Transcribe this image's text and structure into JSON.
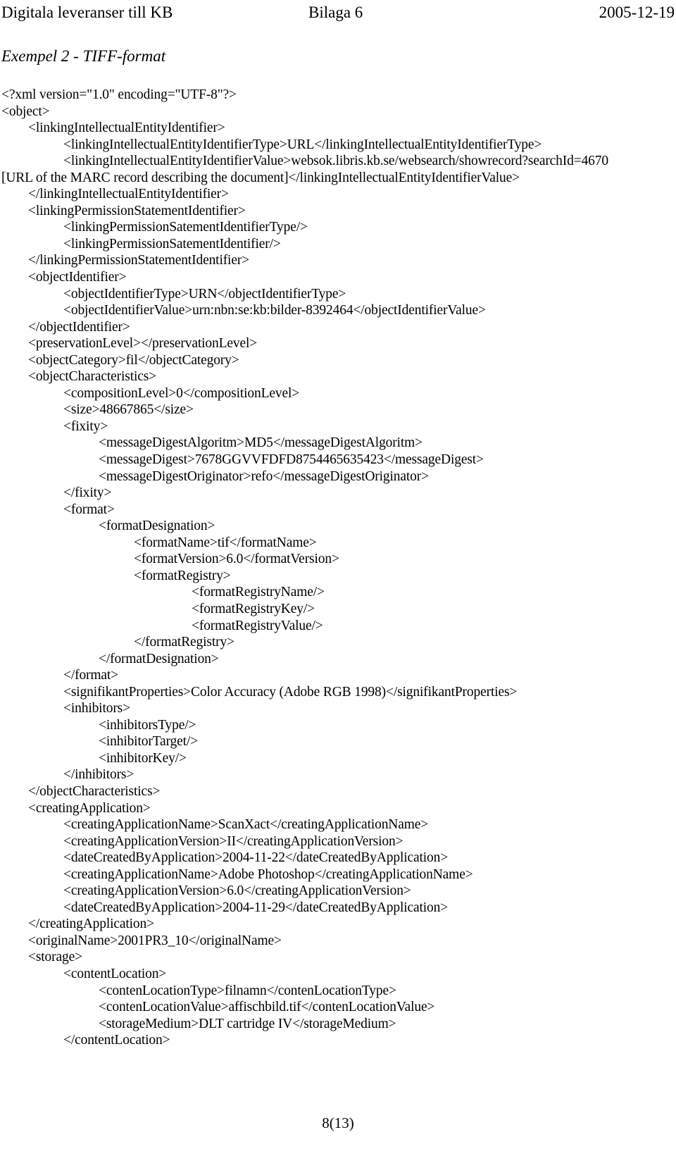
{
  "header": {
    "left": "Digitala leveranser till KB",
    "center": "Bilaga 6",
    "right": "2005-12-19"
  },
  "section": {
    "title": "Exempel 2 - TIFF-format"
  },
  "footer": {
    "page_number": "8(13)"
  },
  "listing": {
    "lines": [
      {
        "indent": 0,
        "text": "<?xml version=\"1.0\" encoding=\"UTF-8\"?>"
      },
      {
        "indent": 0,
        "text": "<object>"
      },
      {
        "indent": 1,
        "text": "<linkingIntellectualEntityIdentifier>"
      },
      {
        "indent": 2,
        "text": "<linkingIntellectualEntityIdentifierType>URL</linkingIntellectualEntityIdentifierType>"
      },
      {
        "indent": 2,
        "text": "<linkingIntellectualEntityIdentifierValue>websok.libris.kb.se/websearch/showrecord?searchId=4670"
      },
      {
        "indent": 0,
        "text": "[URL of the MARC record describing the document]</linkingIntellectualEntityIdentifierValue>"
      },
      {
        "indent": 1,
        "text": "</linkingIntellectualEntityIdentifier>"
      },
      {
        "indent": 1,
        "text": "<linkingPermissionStatementIdentifier>"
      },
      {
        "indent": 2,
        "text": "<linkingPermissionSatementIdentifierType/>"
      },
      {
        "indent": 2,
        "text": "<linkingPermissionSatementIdentifier/>"
      },
      {
        "indent": 1,
        "text": "</linkingPermissionStatementIdentifier>"
      },
      {
        "indent": 1,
        "text": "<objectIdentifier>"
      },
      {
        "indent": 2,
        "text": "<objectIdentifierType>URN</objectIdentifierType>"
      },
      {
        "indent": 2,
        "text": "<objectIdentifierValue>urn:nbn:se:kb:bilder-8392464</objectIdentifierValue>"
      },
      {
        "indent": 1,
        "text": "</objectIdentifier>"
      },
      {
        "indent": 1,
        "text": "<preservationLevel></preservationLevel>"
      },
      {
        "indent": 1,
        "text": "<objectCategory>fil</objectCategory>"
      },
      {
        "indent": 1,
        "text": "<objectCharacteristics>"
      },
      {
        "indent": 2,
        "text": "<compositionLevel>0</compositionLevel>"
      },
      {
        "indent": 2,
        "text": "<size>48667865</size>"
      },
      {
        "indent": 2,
        "text": "<fixity>"
      },
      {
        "indent": 3,
        "text": "<messageDigestAlgoritm>MD5</messageDigestAlgoritm>"
      },
      {
        "indent": 3,
        "text": "<messageDigest>7678GGVVFDFD8754465635423</messageDigest>"
      },
      {
        "indent": 3,
        "text": "<messageDigestOriginator>refo</messageDigestOriginator>"
      },
      {
        "indent": 2,
        "text": "</fixity>"
      },
      {
        "indent": 2,
        "text": "<format>"
      },
      {
        "indent": 3,
        "text": "<formatDesignation>"
      },
      {
        "indent": 4,
        "text": "<formatName>tif</formatName>"
      },
      {
        "indent": 4,
        "text": "<formatVersion>6.0</formatVersion>"
      },
      {
        "indent": 4,
        "text": "<formatRegistry>"
      },
      {
        "indent": 6,
        "text": "<formatRegistryName/>"
      },
      {
        "indent": 6,
        "text": "<formatRegistryKey/>"
      },
      {
        "indent": 6,
        "text": "<formatRegistryValue/>"
      },
      {
        "indent": 4,
        "text": "</formatRegistry>"
      },
      {
        "indent": 3,
        "text": "</formatDesignation>"
      },
      {
        "indent": 2,
        "text": "</format>"
      },
      {
        "indent": 2,
        "text": "<signifikantProperties>Color Accuracy (Adobe RGB 1998)</signifikantProperties>"
      },
      {
        "indent": 2,
        "text": "<inhibitors>"
      },
      {
        "indent": 3,
        "text": "<inhibitorsType/>"
      },
      {
        "indent": 3,
        "text": "<inhibitorTarget/>"
      },
      {
        "indent": 3,
        "text": "<inhibitorKey/>"
      },
      {
        "indent": 2,
        "text": "</inhibitors>"
      },
      {
        "indent": 1,
        "text": "</objectCharacteristics>"
      },
      {
        "indent": 1,
        "text": "<creatingApplication>"
      },
      {
        "indent": 2,
        "text": "<creatingApplicationName>ScanXact</creatingApplicationName>"
      },
      {
        "indent": 2,
        "text": "<creatingApplicationVersion>II</creatingApplicationVersion>"
      },
      {
        "indent": 2,
        "text": "<dateCreatedByApplication>2004-11-22</dateCreatedByApplication>"
      },
      {
        "indent": 2,
        "text": "<creatingApplicationName>Adobe Photoshop</creatingApplicationName>"
      },
      {
        "indent": 2,
        "text": "<creatingApplicationVersion>6.0</creatingApplicationVersion>"
      },
      {
        "indent": 2,
        "text": "<dateCreatedByApplication>2004-11-29</dateCreatedByApplication>"
      },
      {
        "indent": 1,
        "text": "</creatingApplication>"
      },
      {
        "indent": 1,
        "text": "<originalName>2001PR3_10</originalName>"
      },
      {
        "indent": 1,
        "text": "<storage>"
      },
      {
        "indent": 2,
        "text": "<contentLocation>"
      },
      {
        "indent": 3,
        "text": "<contenLocationType>filnamn</contenLocationType>"
      },
      {
        "indent": 3,
        "text": "<contenLocationValue>affischbild.tif</contenLocationValue>"
      },
      {
        "indent": 3,
        "text": "<storageMedium>DLT cartridge IV</storageMedium>"
      },
      {
        "indent": 2,
        "text": "</contentLocation>"
      }
    ]
  }
}
